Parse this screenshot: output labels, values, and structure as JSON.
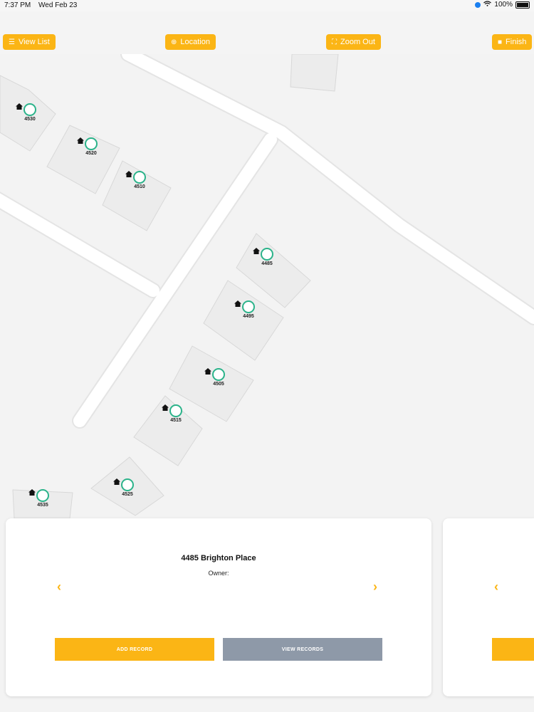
{
  "status_bar": {
    "time": "7:37 PM",
    "date": "Wed Feb 23",
    "battery": "100%"
  },
  "toolbar": {
    "view_list": "View List",
    "location": "Location",
    "zoom_out": "Zoom Out",
    "finish": "Finish"
  },
  "markers": [
    "4530",
    "4520",
    "4510",
    "4485",
    "4495",
    "4505",
    "4515",
    "4525",
    "4535"
  ],
  "card": {
    "address": "4485 Brighton Place",
    "owner_label": "Owner:",
    "add_record": "ADD RECORD",
    "view_records": "VIEW RECORDS"
  },
  "colors": {
    "accent": "#fbb515",
    "secondary": "#8e99a8",
    "marker_ring": "#2bb38a"
  },
  "icons": [
    "list-icon",
    "location-target-icon",
    "zoom-out-icon",
    "stop-icon",
    "house-icon",
    "chevron-left-icon",
    "chevron-right-icon",
    "wifi-icon",
    "location-arrow-icon",
    "battery-icon"
  ]
}
